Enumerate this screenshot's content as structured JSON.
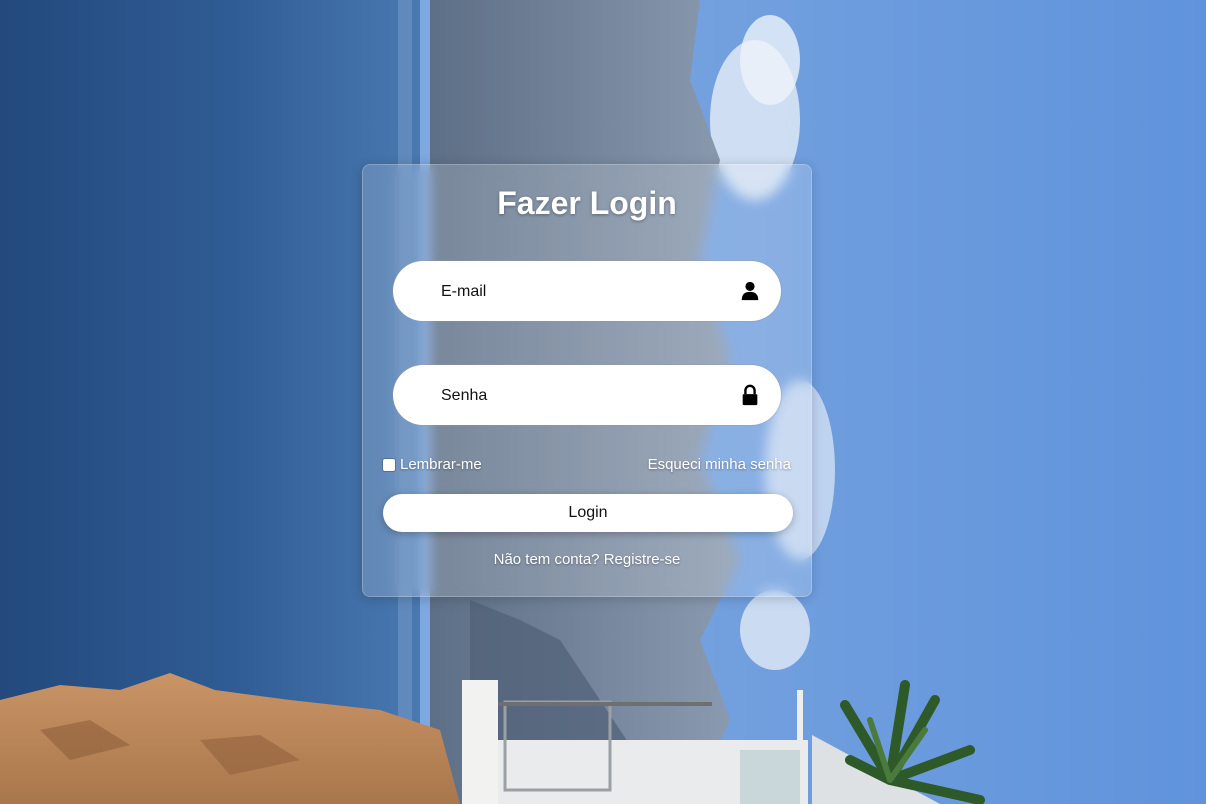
{
  "login": {
    "title": "Fazer Login",
    "email": {
      "placeholder": "E-mail",
      "icon": "user-icon"
    },
    "senha": {
      "placeholder": "Senha",
      "icon": "lock-icon"
    },
    "remember_label": "Lembrar-me",
    "remember_checked": false,
    "forgot_link": "Esqueci minha senha",
    "submit_label": "Login",
    "register_prompt": "Não tem conta?",
    "register_link": "Registre-se"
  },
  "colors": {
    "sky": "#6f9fe0",
    "sea": "#2f5c94",
    "card_bg": "rgba(255,255,255,0.17)",
    "button_bg": "#ffffff",
    "text_light": "#ffffff"
  }
}
